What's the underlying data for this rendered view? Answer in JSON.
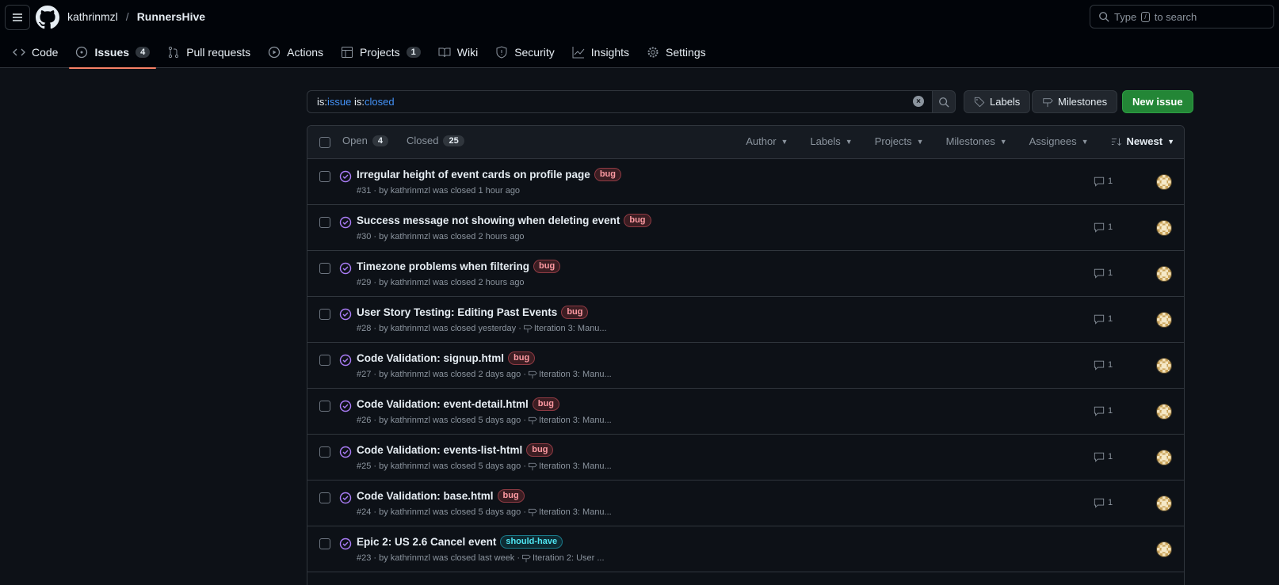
{
  "header": {
    "owner": "kathrinmzl",
    "separator": "/",
    "repo": "RunnersHive",
    "search_placeholder_pre": "Type",
    "search_key": "/",
    "search_placeholder_post": "to search"
  },
  "tabs": [
    {
      "label": "Code",
      "icon": "code-icon"
    },
    {
      "label": "Issues",
      "icon": "issue-icon",
      "count": "4",
      "active": true
    },
    {
      "label": "Pull requests",
      "icon": "pull-request-icon"
    },
    {
      "label": "Actions",
      "icon": "play-icon"
    },
    {
      "label": "Projects",
      "icon": "table-icon",
      "count": "1"
    },
    {
      "label": "Wiki",
      "icon": "book-icon"
    },
    {
      "label": "Security",
      "icon": "shield-icon"
    },
    {
      "label": "Insights",
      "icon": "graph-icon"
    },
    {
      "label": "Settings",
      "icon": "gear-icon"
    }
  ],
  "filter": {
    "key1": "is:",
    "val1": "issue",
    "key2": "is:",
    "val2": "closed"
  },
  "buttons": {
    "labels": "Labels",
    "milestones": "Milestones",
    "new_issue": "New issue"
  },
  "list_header": {
    "open_label": "Open",
    "open_count": "4",
    "closed_label": "Closed",
    "closed_count": "25",
    "filters": [
      "Author",
      "Labels",
      "Projects",
      "Milestones",
      "Assignees"
    ],
    "sort": "Newest"
  },
  "issues": [
    {
      "title": "Irregular height of event cards on profile page",
      "label": "bug",
      "meta": "#31 · by kathrinmzl was closed 1 hour ago",
      "milestone": "",
      "comments": "1"
    },
    {
      "title": "Success message not showing when deleting event",
      "label": "bug",
      "meta": "#30 · by kathrinmzl was closed 2 hours ago",
      "milestone": "",
      "comments": "1"
    },
    {
      "title": "Timezone problems when filtering",
      "label": "bug",
      "meta": "#29 · by kathrinmzl was closed 2 hours ago",
      "milestone": "",
      "comments": "1"
    },
    {
      "title": "User Story Testing: Editing Past Events",
      "label": "bug",
      "meta": "#28 · by kathrinmzl was closed yesterday ·",
      "milestone": "Iteration 3: Manu...",
      "comments": "1"
    },
    {
      "title": "Code Validation: signup.html",
      "label": "bug",
      "meta": "#27 · by kathrinmzl was closed 2 days ago ·",
      "milestone": "Iteration 3: Manu...",
      "comments": "1"
    },
    {
      "title": "Code Validation: event-detail.html",
      "label": "bug",
      "meta": "#26 · by kathrinmzl was closed 5 days ago ·",
      "milestone": "Iteration 3: Manu...",
      "comments": "1"
    },
    {
      "title": "Code Validation: events-list-html",
      "label": "bug",
      "meta": "#25 · by kathrinmzl was closed 5 days ago ·",
      "milestone": "Iteration 3: Manu...",
      "comments": "1"
    },
    {
      "title": "Code Validation: base.html",
      "label": "bug",
      "meta": "#24 · by kathrinmzl was closed 5 days ago ·",
      "milestone": "Iteration 3: Manu...",
      "comments": "1"
    },
    {
      "title": "Epic 2: US 2.6 Cancel event",
      "label": "should-have",
      "meta": "#23 · by kathrinmzl was closed last week ·",
      "milestone": "Iteration 2: User ...",
      "comments": ""
    }
  ]
}
